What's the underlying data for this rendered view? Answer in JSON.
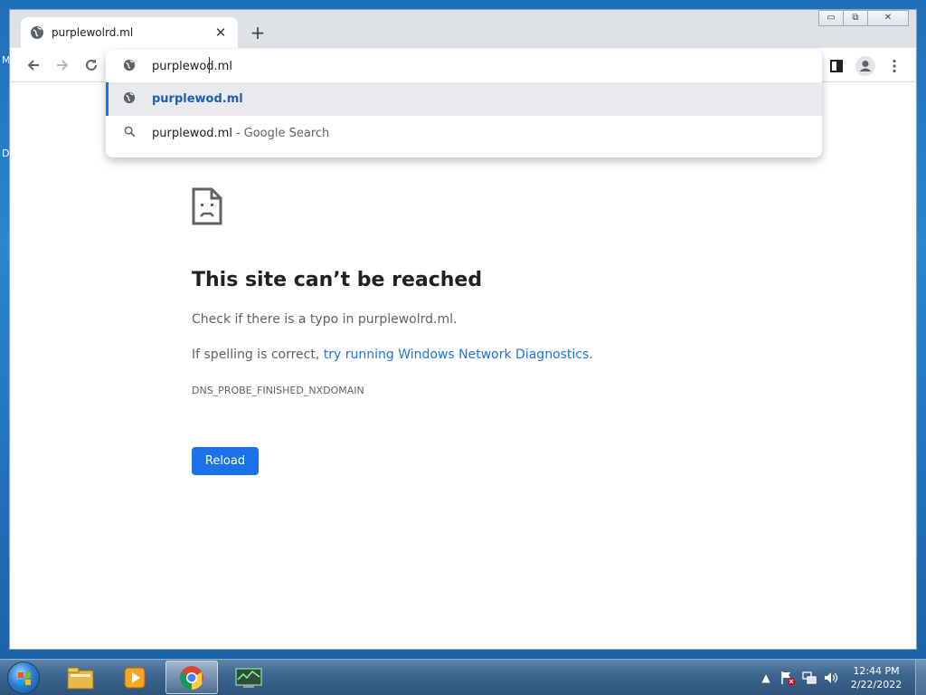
{
  "browser": {
    "tab": {
      "title": "purplewolrd.ml",
      "close_icon": "close-icon",
      "favicon": "globe-icon"
    },
    "new_tab_label": "+",
    "window_controls": {
      "minimize": "▭",
      "maximize": "⧉",
      "close": "✕"
    },
    "toolbar": {
      "back_icon": "arrow-left-icon",
      "forward_icon": "arrow-right-icon",
      "reload_icon": "reload-icon",
      "side_panel_icon": "side-panel-icon",
      "profile_icon": "profile-icon",
      "menu_icon": "kebab-menu-icon"
    },
    "omnibox": {
      "input_value": "purplewod.ml",
      "suggestions": [
        {
          "icon": "globe-icon",
          "text": "purplewod.ml",
          "selected": true
        },
        {
          "icon": "search-icon",
          "text": "purplewod.ml",
          "separator": "-",
          "description": "Google Search"
        }
      ]
    }
  },
  "error_page": {
    "title": "This site can’t be reached",
    "line1": "Check if there is a typo in purplewolrd.ml.",
    "line2_prefix": "If spelling is correct, ",
    "line2_link": "try running Windows Network Diagnostics",
    "line2_suffix": ".",
    "error_code": "DNS_PROBE_FINISHED_NXDOMAIN",
    "reload_button": "Reload"
  },
  "taskbar": {
    "apps": [
      "file-explorer-icon",
      "media-player-icon",
      "chrome-icon",
      "system-monitor-icon"
    ],
    "clock_time": "12:44 PM",
    "clock_date": "2/22/2022"
  },
  "desktop_letters": [
    "M",
    "D"
  ],
  "colors": {
    "accent": "#1a73e8",
    "link": "#1a73e8"
  }
}
